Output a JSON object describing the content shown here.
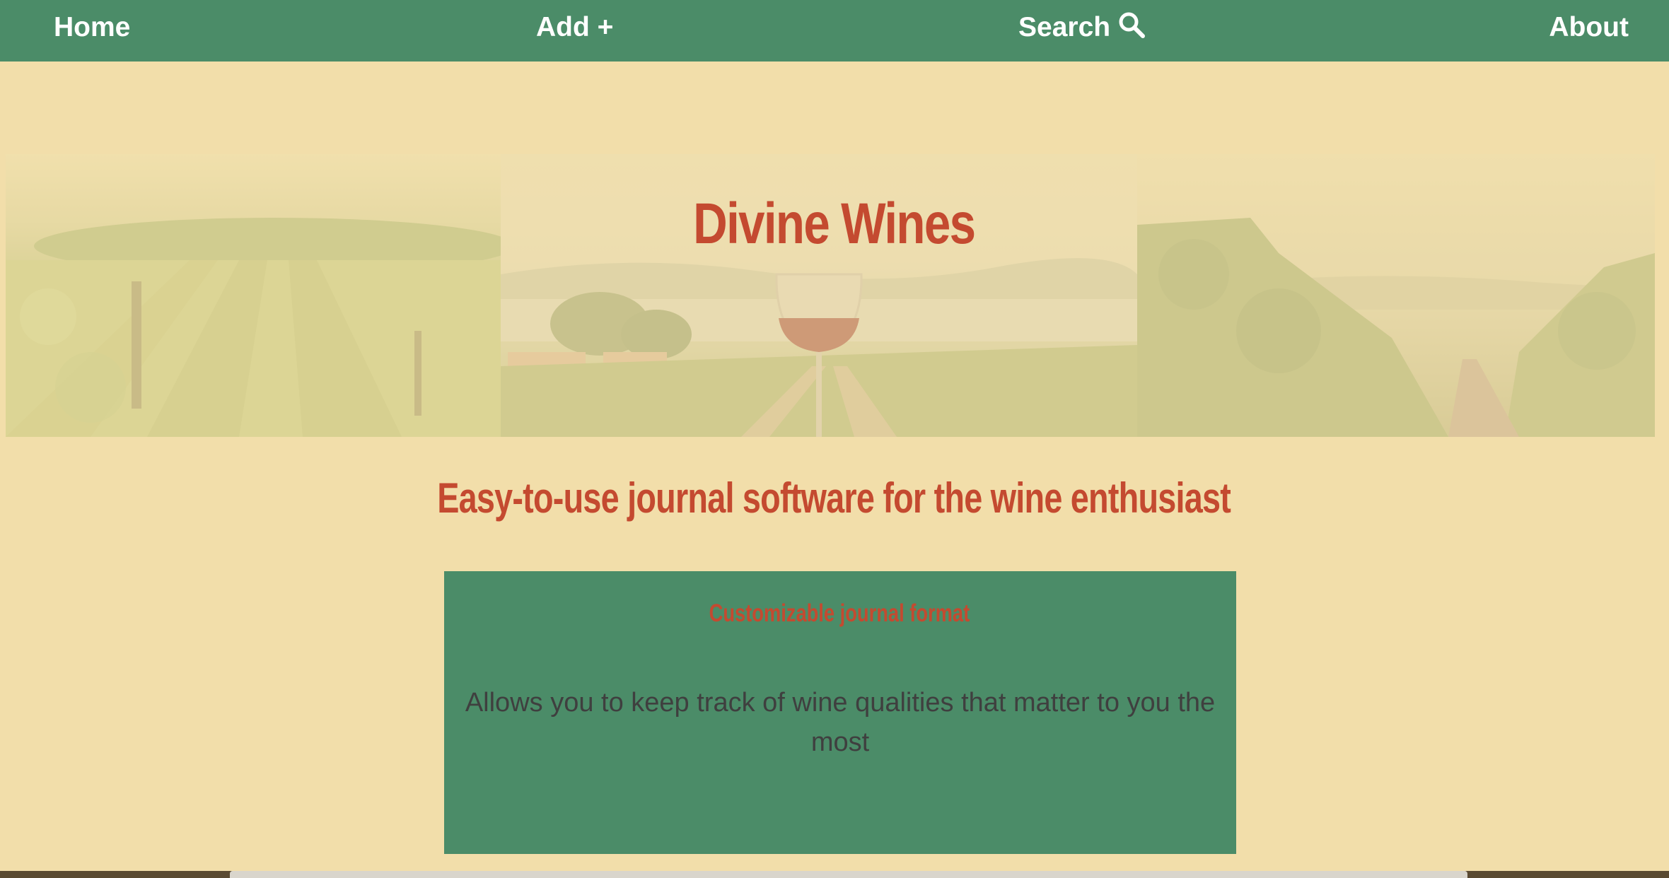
{
  "nav": {
    "home_label": "Home",
    "add_label": "Add +",
    "search_label": "Search",
    "search_icon": "search-icon",
    "about_label": "About"
  },
  "hero": {
    "title": "Divine Wines",
    "images": [
      "vineyard-field-image",
      "wine-glass-lake-image",
      "grapevine-rows-image"
    ]
  },
  "tagline": "Easy-to-use journal software for the wine enthusiast",
  "feature": {
    "title": "Customizable journal format",
    "description": "Allows you to keep track of wine qualities that matter to you the most"
  },
  "colors": {
    "background": "#f2deaa",
    "nav_bg": "#4b8c68",
    "accent": "#c44a30",
    "card_bg": "#4b8c68",
    "body_text": "#3f3f3f"
  }
}
